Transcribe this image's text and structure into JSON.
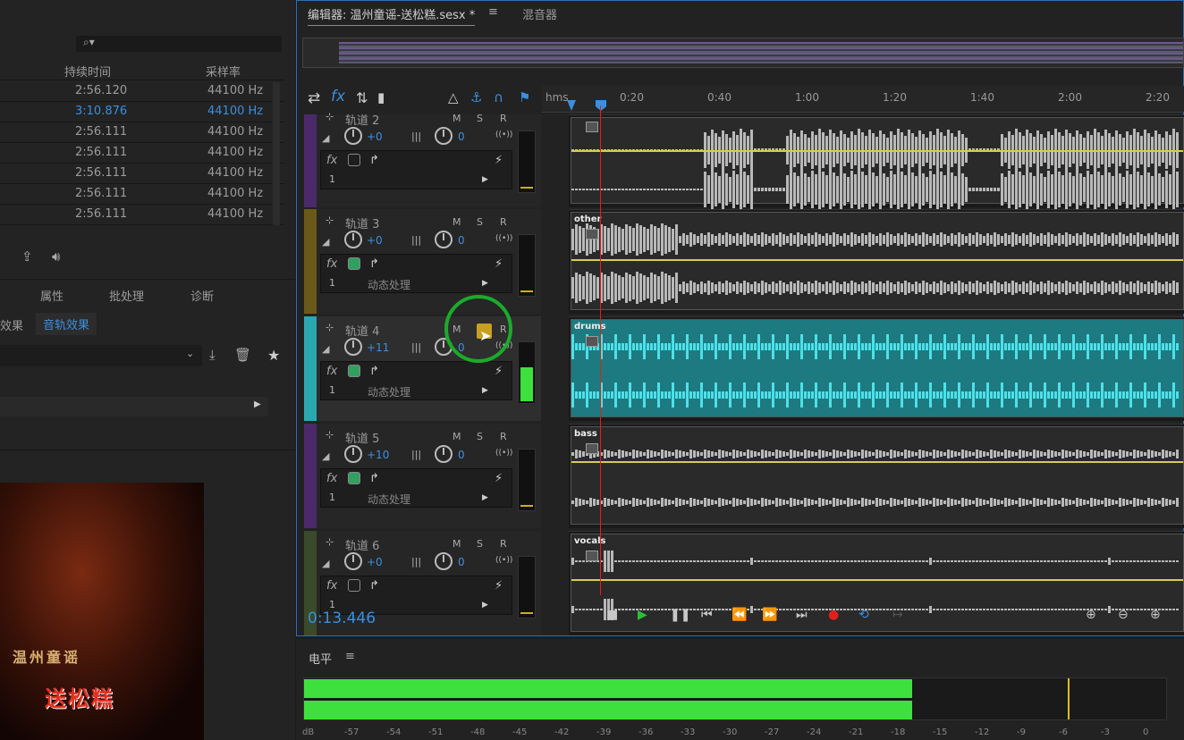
{
  "left_panel": {
    "columns": {
      "duration": "持续时间",
      "sample_rate": "采样率"
    },
    "files": [
      {
        "duration": "2:56.120",
        "sample_rate": "44100 Hz",
        "selected": false
      },
      {
        "duration": "3:10.876",
        "sample_rate": "44100 Hz",
        "selected": true
      },
      {
        "duration": "2:56.111",
        "sample_rate": "44100 Hz",
        "selected": false
      },
      {
        "duration": "2:56.111",
        "sample_rate": "44100 Hz",
        "selected": false
      },
      {
        "duration": "2:56.111",
        "sample_rate": "44100 Hz",
        "selected": false
      },
      {
        "duration": "2:56.111",
        "sample_rate": "44100 Hz",
        "selected": false
      },
      {
        "duration": "2:56.111",
        "sample_rate": "44100 Hz",
        "selected": false
      }
    ],
    "tabs": [
      "属性",
      "批处理",
      "诊断"
    ],
    "subtabs": [
      "效果",
      "音轨效果"
    ],
    "video_text": {
      "line1": "温州童谣",
      "line2": "送松糕"
    }
  },
  "editor": {
    "tab_title": "编辑器: 温州童谣-送松糕.sesx *",
    "mixer_tab": "混音器",
    "ruler": [
      "hms",
      "0:20",
      "0:40",
      "1:00",
      "1:20",
      "1:40",
      "2:00",
      "2:20"
    ],
    "tracks": [
      {
        "name": "轨道 2",
        "vol": "+0",
        "pan": "0",
        "clip": "",
        "color": "#4a2a6a",
        "fx_label": "",
        "selected": false
      },
      {
        "name": "轨道 3",
        "vol": "+0",
        "pan": "0",
        "clip": "other",
        "color": "#6a5a1a",
        "fx_label": "动态处理",
        "selected": false
      },
      {
        "name": "轨道 4",
        "vol": "+11",
        "pan": "0",
        "clip": "drums",
        "color": "#2aa8b0",
        "fx_label": "动态处理",
        "selected": true
      },
      {
        "name": "轨道 5",
        "vol": "+10",
        "pan": "0",
        "clip": "bass",
        "color": "#4a2a6a",
        "fx_label": "动态处理",
        "selected": false
      },
      {
        "name": "轨道 6",
        "vol": "+0",
        "pan": "0",
        "clip": "vocals",
        "color": "#3a4a2a",
        "fx_label": "",
        "selected": false
      }
    ],
    "time": "0:13.446",
    "msr": [
      "M",
      "S",
      "R"
    ],
    "fx_channel": "1"
  },
  "level": {
    "title": "电平",
    "ticks": [
      "dB",
      "-57",
      "-54",
      "-51",
      "-48",
      "-45",
      "-42",
      "-39",
      "-36",
      "-33",
      "-30",
      "-27",
      "-24",
      "-21",
      "-18",
      "-15",
      "-12",
      "-9",
      "-6",
      "-3",
      "0"
    ],
    "level_fraction": 0.705
  },
  "colors": {
    "accent": "#3a8fe0",
    "meter": "#3ee03e",
    "drums": "#1fa0a4"
  }
}
